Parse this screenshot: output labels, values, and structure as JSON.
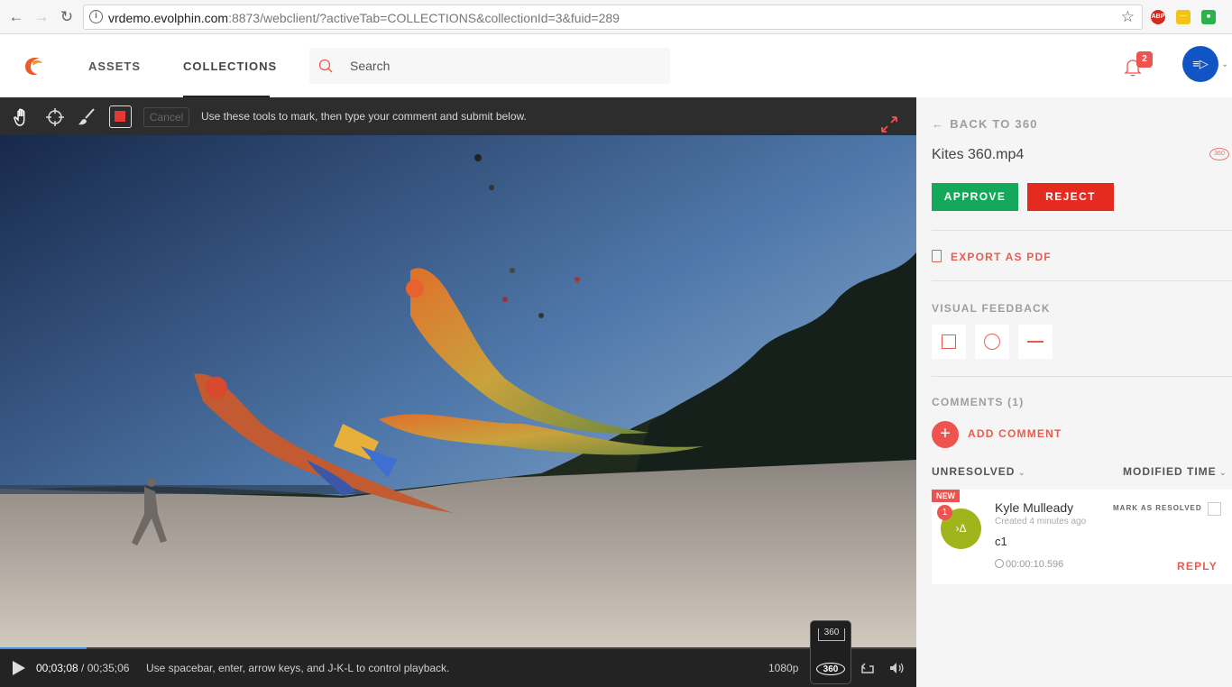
{
  "browser": {
    "url_host": "vrdemo.evolphin.com",
    "url_rest": ":8873/webclient/?activeTab=COLLECTIONS&collectionId=3&fuid=289",
    "ext_abp": "ABP"
  },
  "header": {
    "nav": [
      {
        "label": "ASSETS"
      },
      {
        "label": "COLLECTIONS"
      }
    ],
    "search_placeholder": "Search",
    "notification_count": "2"
  },
  "player": {
    "cancel_label": "Cancel",
    "tool_hint": "Use these tools to mark, then type your comment and submit below.",
    "current_time": "00;03;08",
    "time_sep": " / ",
    "duration": "00;35;06",
    "controls_hint": "Use spacebar, enter, arrow keys, and J-K-L to control playback.",
    "quality": "1080p",
    "vr_top_label": "360",
    "vr_bottom_label": "360",
    "progress": 0.094
  },
  "sidebar": {
    "back_label": "BACK TO 360",
    "file_name": "Kites 360.mp4",
    "file_badge": "360",
    "approve_label": "APPROVE",
    "reject_label": "REJECT",
    "export_label": "EXPORT AS PDF",
    "visual_feedback_label": "VISUAL FEEDBACK",
    "comments_label": "COMMENTS (1)",
    "add_comment_label": "ADD COMMENT",
    "filter_status": "UNRESOLVED",
    "filter_sort": "MODIFIED TIME",
    "comment": {
      "tag": "NEW",
      "number": "1",
      "author": "Kyle Mulleady",
      "created": "Created 4 minutes ago",
      "body": "c1",
      "timecode": "00:00:10.596",
      "mark_label": "MARK AS RESOLVED",
      "reply_label": "REPLY"
    }
  },
  "colors": {
    "accent": "#e65d4f",
    "approve": "#13a85a",
    "reject": "#e52a1f",
    "avatar": "#1155c4",
    "comment_avatar": "#a0b51b"
  },
  "icons": [
    "back-arrow-icon",
    "forward-arrow-icon",
    "reload-icon",
    "info-icon",
    "star-icon",
    "search-icon",
    "bell-icon",
    "hand-icon",
    "crosshair-icon",
    "brush-icon",
    "record-icon",
    "expand-icon",
    "play-icon",
    "loop-icon",
    "volume-icon",
    "pdf-icon",
    "square-icon",
    "circle-icon",
    "line-icon",
    "plus-icon",
    "clock-icon"
  ]
}
